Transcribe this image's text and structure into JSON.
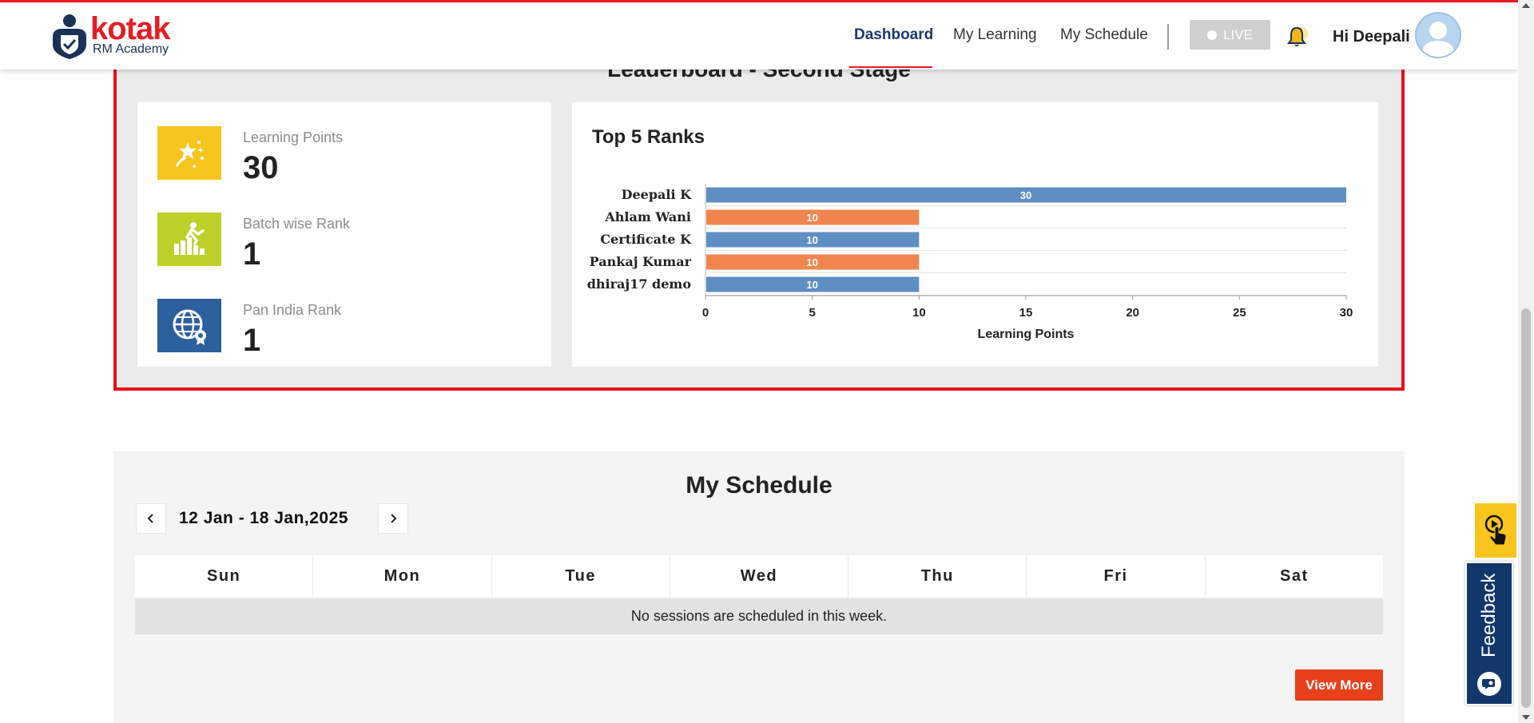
{
  "header": {
    "logo_brand": "kotak",
    "logo_sub": "RM Academy",
    "nav": [
      {
        "label": "Dashboard",
        "active": true
      },
      {
        "label": "My Learning",
        "active": false
      },
      {
        "label": "My Schedule",
        "active": false
      }
    ],
    "live_label": "LIVE",
    "greeting": "Hi Deepali",
    "icons": {
      "bell": "bell-icon",
      "avatar": "user-avatar-icon"
    }
  },
  "leaderboard": {
    "title": "Leaderboard - Second Stage",
    "stats": [
      {
        "label": "Learning Points",
        "value": "30",
        "icon": "trophy-stars-icon",
        "color": "#f7c51e"
      },
      {
        "label": "Batch wise Rank",
        "value": "1",
        "icon": "runner-stairs-icon",
        "color": "#bfd02a"
      },
      {
        "label": "Pan India Rank",
        "value": "1",
        "icon": "globe-badge-icon",
        "color": "#2c5f9e"
      }
    ],
    "chart_title": "Top 5 Ranks"
  },
  "chart_data": {
    "type": "bar",
    "orientation": "horizontal",
    "title": "Top 5 Ranks",
    "categories": [
      "Deepali K",
      "Ahlam Wani",
      "Certificate K",
      "Pankaj Kumar",
      "dhiraj17 demo"
    ],
    "values": [
      30,
      10,
      10,
      10,
      10
    ],
    "bar_colors": [
      "#5f8fc2",
      "#f0854f",
      "#5f8fc2",
      "#f0854f",
      "#5f8fc2"
    ],
    "xlabel": "Learning Points",
    "ylabel": "",
    "xlim": [
      0,
      30
    ],
    "xticks": [
      "0",
      "5",
      "10",
      "15",
      "20",
      "25",
      "30"
    ],
    "data_labels": true,
    "grid": true
  },
  "schedule": {
    "title": "My Schedule",
    "week_range": "12 Jan - 18 Jan,2025",
    "days": [
      "Sun",
      "Mon",
      "Tue",
      "Wed",
      "Thu",
      "Fri",
      "Sat"
    ],
    "empty_message": "No sessions are scheduled in this week.",
    "view_more_label": "View More"
  },
  "widgets": {
    "feedback_label": "Feedback",
    "tour_icon": "hand-pointer-play-icon"
  }
}
